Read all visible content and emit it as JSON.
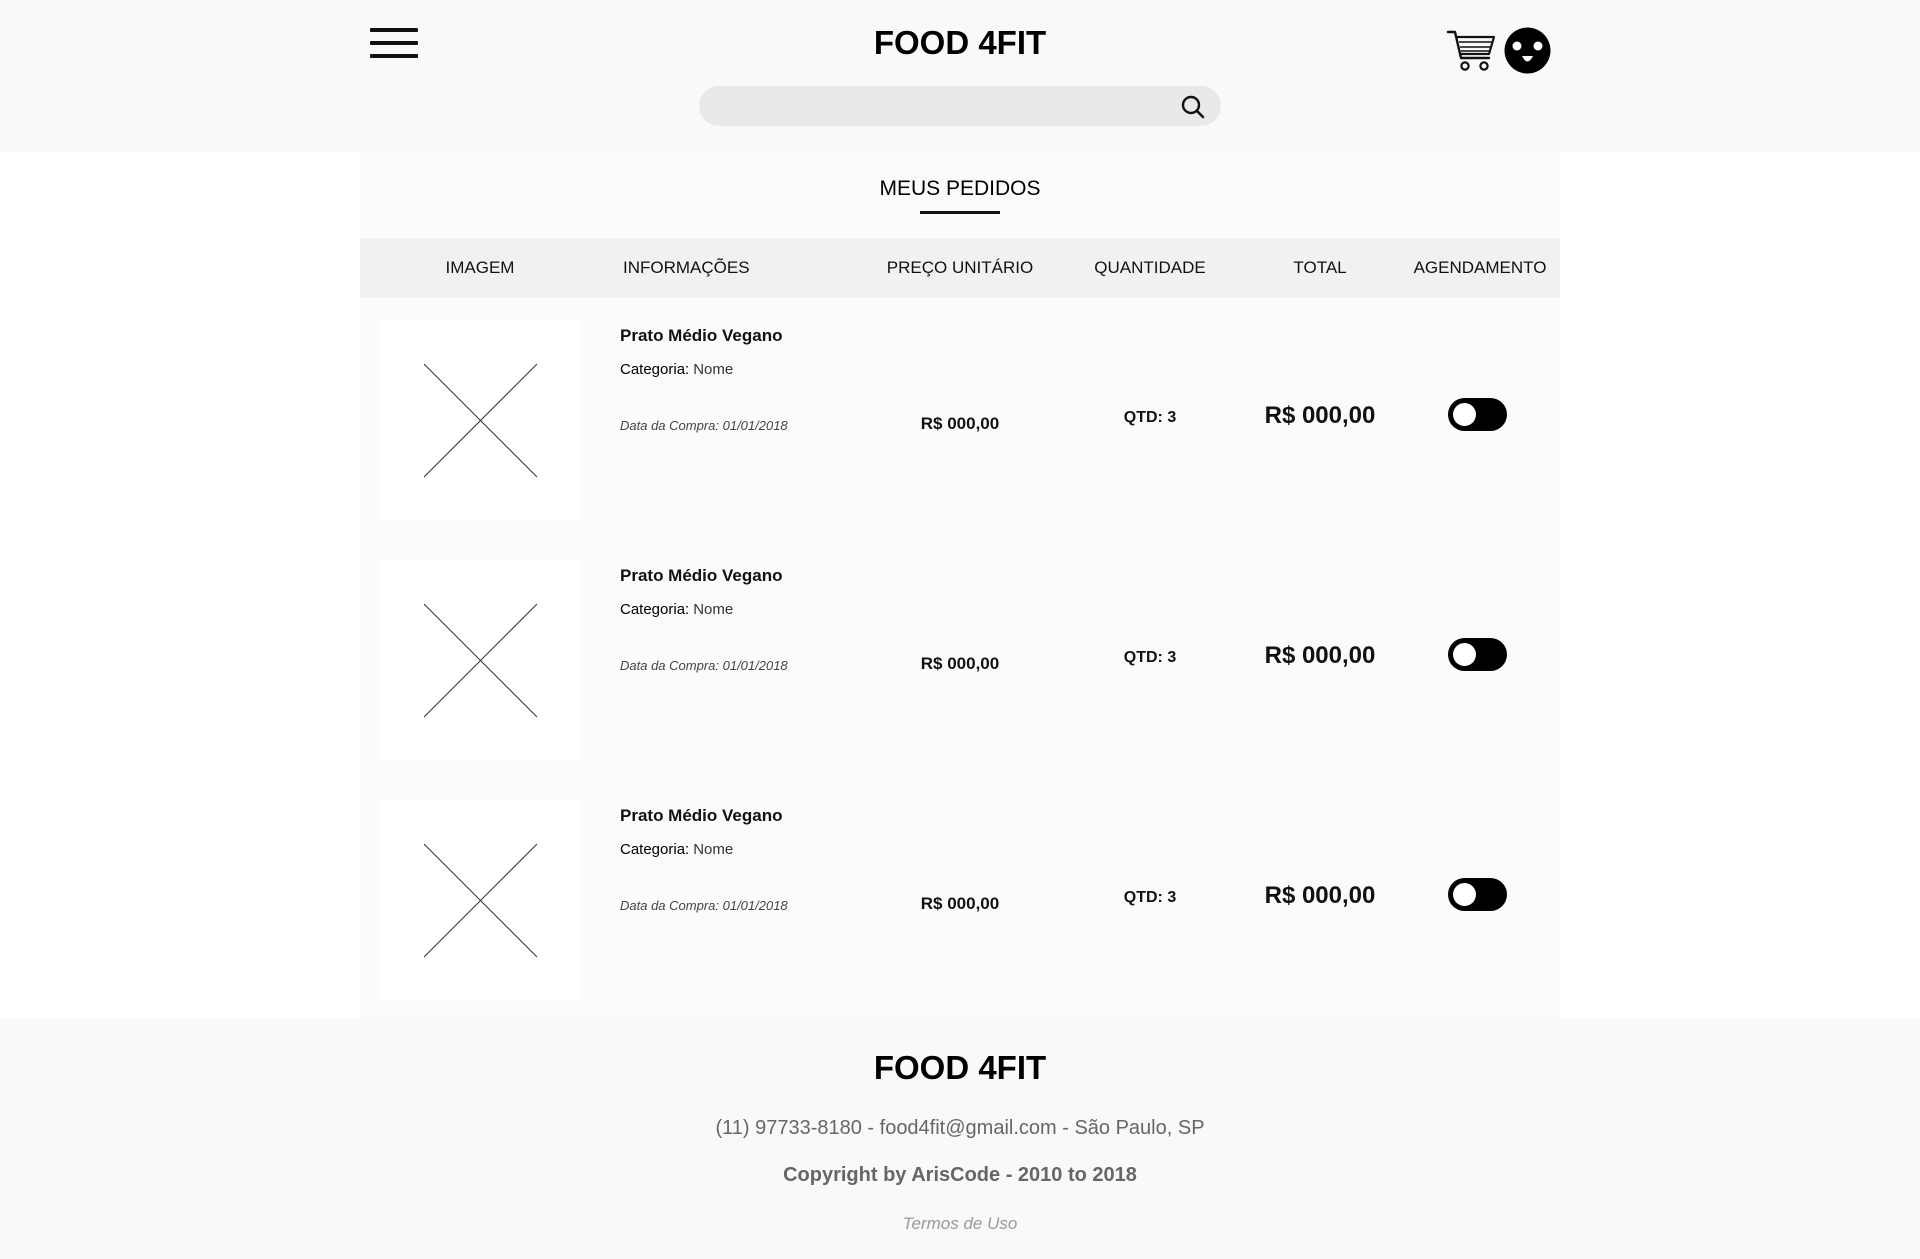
{
  "header": {
    "brand": "FOOD 4FIT",
    "search": {
      "placeholder": ""
    }
  },
  "page": {
    "title": "MEUS PEDIDOS"
  },
  "table": {
    "columns": [
      "IMAGEM",
      "INFORMAÇÕES",
      "PREÇO UNITÁRIO",
      "QUANTIDADE",
      "TOTAL",
      "AGENDAMENTO"
    ],
    "rows": [
      {
        "name": "Prato Médio Vegano",
        "category_label": "Categoria:",
        "category_value": "Nome",
        "purchase_date": "Data da Compra: 01/01/2018",
        "unit_price": "R$ 000,00",
        "quantity": "QTD: 3",
        "total": "R$ 000,00",
        "scheduling_on": true
      },
      {
        "name": "Prato Médio Vegano",
        "category_label": "Categoria:",
        "category_value": "Nome",
        "purchase_date": "Data da Compra: 01/01/2018",
        "unit_price": "R$ 000,00",
        "quantity": "QTD: 3",
        "total": "R$ 000,00",
        "scheduling_on": true
      },
      {
        "name": "Prato Médio Vegano",
        "category_label": "Categoria:",
        "category_value": "Nome",
        "purchase_date": "Data da Compra: 01/01/2018",
        "unit_price": "R$ 000,00",
        "quantity": "QTD: 3",
        "total": "R$ 000,00",
        "scheduling_on": true
      }
    ]
  },
  "footer": {
    "brand": "FOOD 4FIT",
    "contact": "(11) 97733-8180 - food4fit@gmail.com - São Paulo, SP",
    "copyright": "Copyright by ArisCode - 2010 to 2018",
    "terms": "Termos de Uso"
  },
  "icons": [
    "menu-icon",
    "cart-icon",
    "avatar-icon",
    "search-icon",
    "image-placeholder-icon"
  ],
  "colors": {
    "toggle": "#000000",
    "header_bg": "#f9f9f9",
    "search_bg": "#e9e9e9"
  }
}
